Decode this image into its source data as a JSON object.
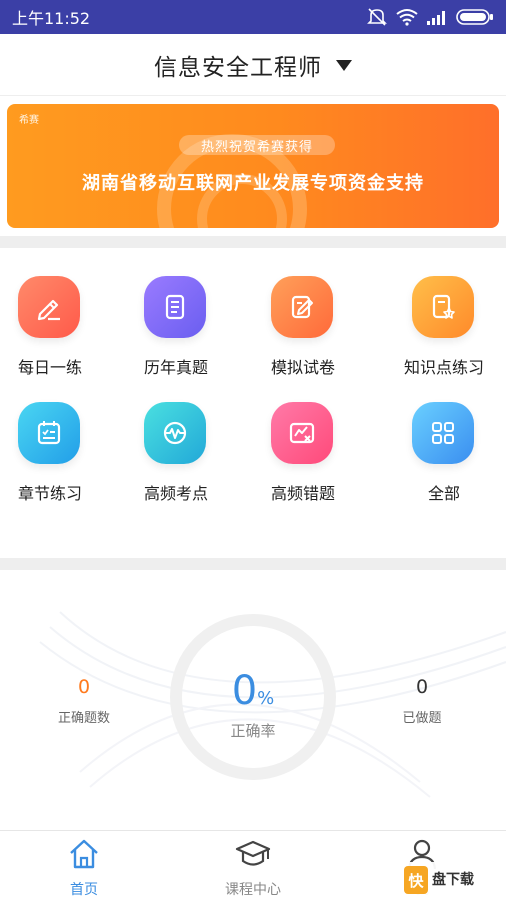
{
  "status_bar": {
    "time": "上午11:52"
  },
  "header": {
    "title": "信息安全工程师"
  },
  "banner": {
    "brand": "希赛",
    "pill": "热烈祝贺希赛获得",
    "headline": "湖南省移动互联网产业发展专项资金支持"
  },
  "grid": {
    "items": [
      {
        "label": "每日一练",
        "icon": "pencil-icon",
        "color": "#ff6e5a"
      },
      {
        "label": "历年真题",
        "icon": "document-icon",
        "color": "#7b6cf6"
      },
      {
        "label": "模拟试卷",
        "icon": "edit-paper-icon",
        "color": "#ff7a45"
      },
      {
        "label": "知识点练习",
        "icon": "star-document-icon",
        "color": "#ff9a2e"
      },
      {
        "label": "章节练习",
        "icon": "checklist-icon",
        "color": "#2fb8ec"
      },
      {
        "label": "高频考点",
        "icon": "pulse-icon",
        "color": "#2ec5d8"
      },
      {
        "label": "高频错题",
        "icon": "wrong-chart-icon",
        "color": "#ff5d8f"
      },
      {
        "label": "全部",
        "icon": "grid-icon",
        "color": "#4aa7f2"
      }
    ]
  },
  "stats": {
    "correct_count": "0",
    "correct_count_label": "正确题数",
    "rate_value": "0",
    "rate_symbol": "%",
    "rate_label": "正确率",
    "done_count": "0",
    "done_count_label": "已做题"
  },
  "tabbar": {
    "tabs": [
      {
        "label": "首页",
        "icon": "home-icon",
        "active": true
      },
      {
        "label": "课程中心",
        "icon": "graduation-cap-icon",
        "active": false
      },
      {
        "label": "我",
        "icon": "user-icon",
        "active": false
      }
    ]
  },
  "watermark": {
    "logo": "快",
    "text": "盘下载"
  },
  "colors": {
    "accent": "#3b8de0",
    "status_bar": "#3b3fa6",
    "orange": "#ff7a1e"
  }
}
